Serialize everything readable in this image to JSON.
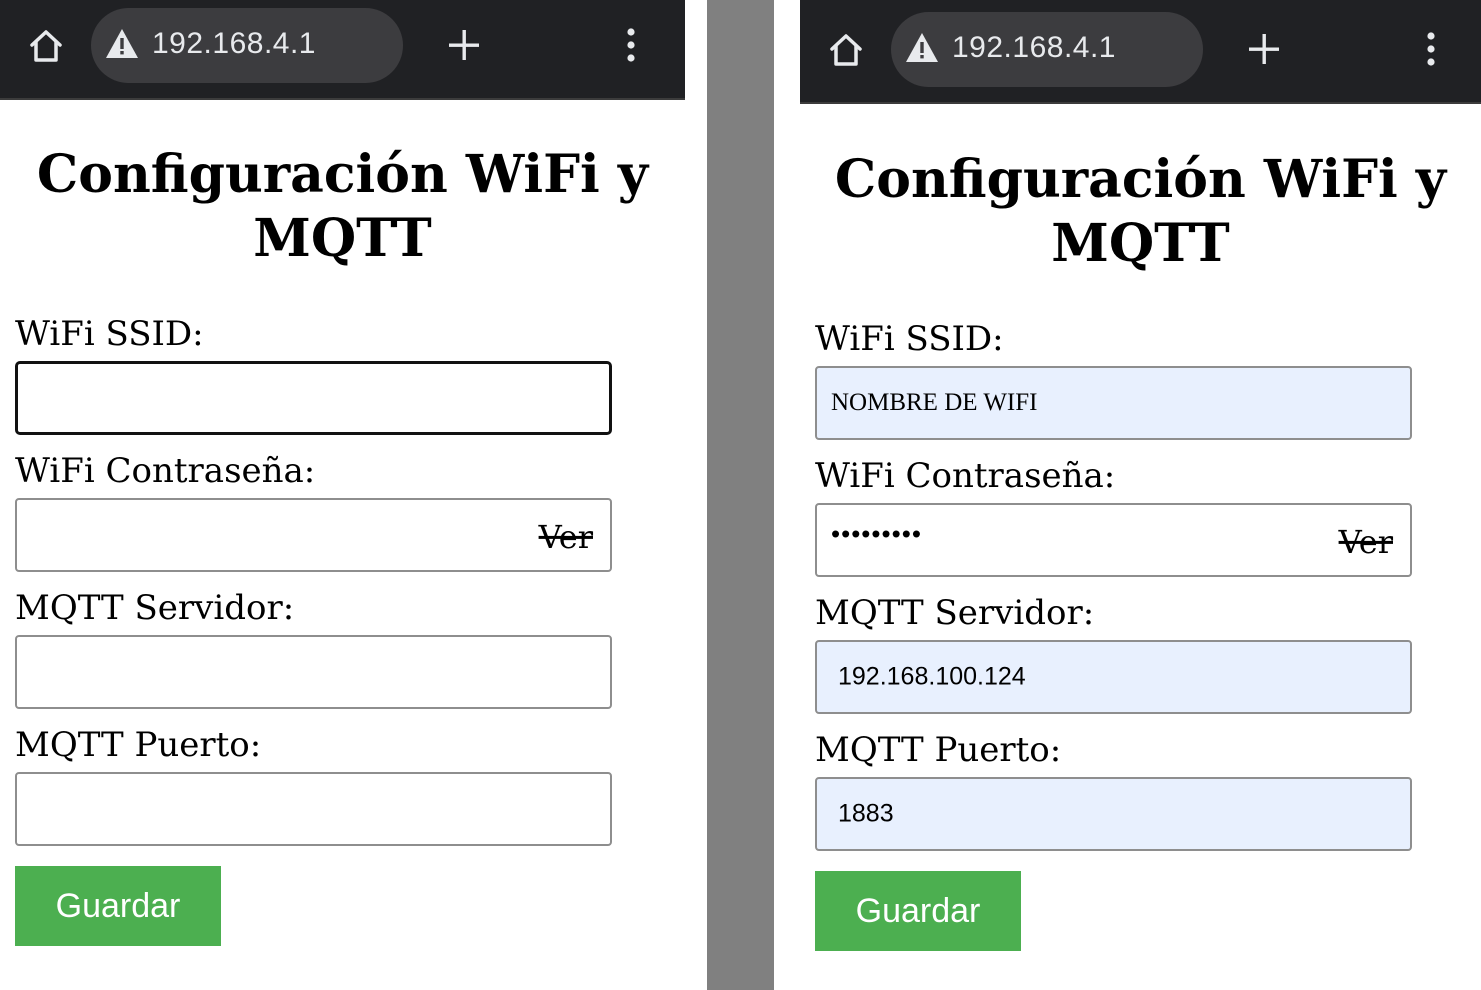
{
  "colors": {
    "toolbar_bg": "#202124",
    "urlbar_bg": "#3c3c3f",
    "divider": "#808080",
    "button_green": "#4caf50",
    "autofill_bg": "#e8f0fe"
  },
  "panels": [
    {
      "browser": {
        "url": "192.168.4.1",
        "icons": [
          "home-icon",
          "warning-triangle-icon",
          "plus-icon",
          "more-vertical-icon"
        ]
      },
      "form": {
        "title": "Configuración WiFi y MQTT",
        "ssid_label": "WiFi SSID:",
        "ssid_value": "",
        "password_label": "WiFi Contraseña:",
        "password_value": "",
        "password_toggle": "Ver",
        "server_label": "MQTT Servidor:",
        "server_value": "",
        "port_label": "MQTT Puerto:",
        "port_value": "",
        "save_label": "Guardar"
      }
    },
    {
      "browser": {
        "url": "192.168.4.1",
        "icons": [
          "home-icon",
          "warning-triangle-icon",
          "plus-icon",
          "more-vertical-icon"
        ]
      },
      "form": {
        "title": "Configuración WiFi y MQTT",
        "ssid_label": "WiFi SSID:",
        "ssid_value": "NOMBRE DE WIFI",
        "password_label": "WiFi Contraseña:",
        "password_value": "•••••••••",
        "password_toggle": "Ver",
        "server_label": "MQTT Servidor:",
        "server_value": "192.168.100.124",
        "port_label": "MQTT Puerto:",
        "port_value": "1883",
        "save_label": "Guardar"
      }
    }
  ]
}
